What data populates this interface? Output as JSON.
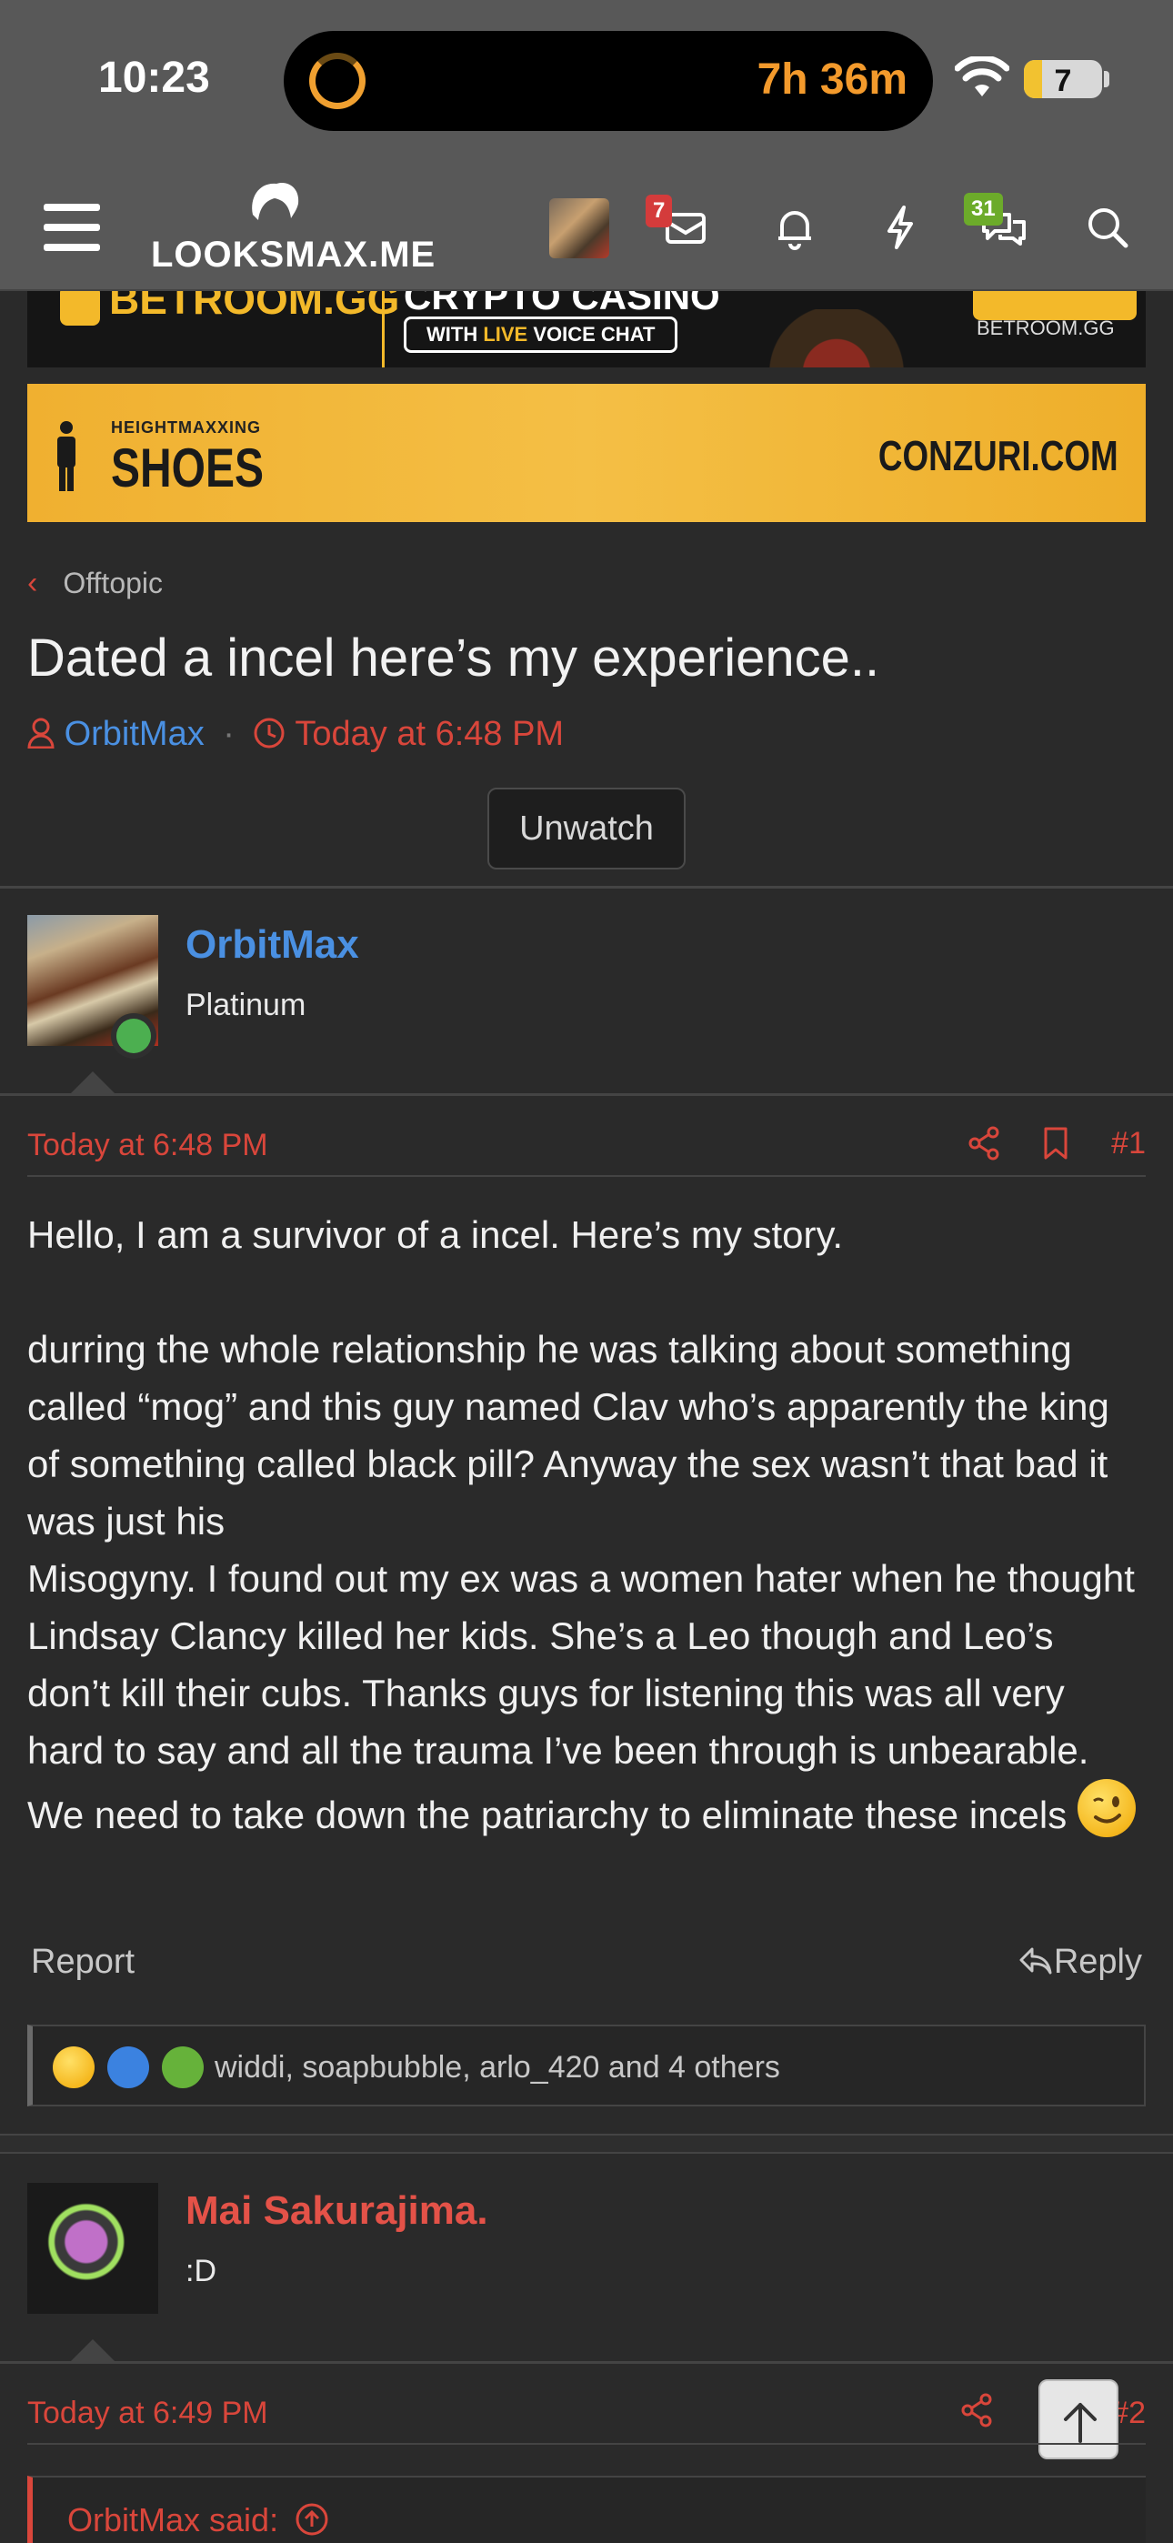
{
  "status_bar": {
    "time": "10:23",
    "timer": "7h 36m",
    "battery": "7"
  },
  "nav": {
    "logo": "LOOKSMAX.ME",
    "inbox_badge": "7",
    "conversations_badge": "31"
  },
  "ads": {
    "banner1": {
      "brand": "BETROOM.GG",
      "title": "CRYPTO CASINO",
      "sub_prefix": "WITH ",
      "sub_live": "LIVE",
      "sub_suffix": " VOICE CHAT",
      "url": "BETROOM.GG"
    },
    "banner2": {
      "small": "HEIGHTMAXXING",
      "big": "SHOES",
      "url": "CONZURI.COM"
    }
  },
  "breadcrumb": "Offtopic",
  "thread": {
    "title": "Dated a incel here’s my experience..",
    "author": "OrbitMax",
    "time": "Today at 6:48 PM",
    "watch_label": "Unwatch"
  },
  "posts": [
    {
      "author": "OrbitMax",
      "user_title": "Platinum",
      "time": "Today at 6:48 PM",
      "number": "#1",
      "body_p1": "Hello, I am a survivor of a incel. Here’s my story.",
      "body_p2": "durring the whole relationship he was talking about something called “mog” and this guy named Clav who’s apparently the king of something called black pill? Anyway the sex wasn’t that bad it was just his",
      "body_p3": "Misogyny. I found out my ex was a women hater when he thought Lindsay Clancy killed her kids. She’s a Leo though and Leo’s don’t kill their cubs. Thanks guys for listening this was all very hard to say and all the trauma I’ve been through is unbearable. We need to take down the patriarchy to eliminate these incels",
      "report_label": "Report",
      "reply_label": "Reply",
      "reactions": "widdi, soapbubble, arlo_420 and 4 others"
    },
    {
      "author": "Mai Sakurajima.",
      "user_title": ":D",
      "time": "Today at 6:49 PM",
      "number": "#2",
      "quote_header": "OrbitMax said:"
    }
  ],
  "colors": {
    "accent_red": "#d9463b",
    "link_blue": "#4a90e2",
    "ad_yellow": "#f3b92a"
  }
}
